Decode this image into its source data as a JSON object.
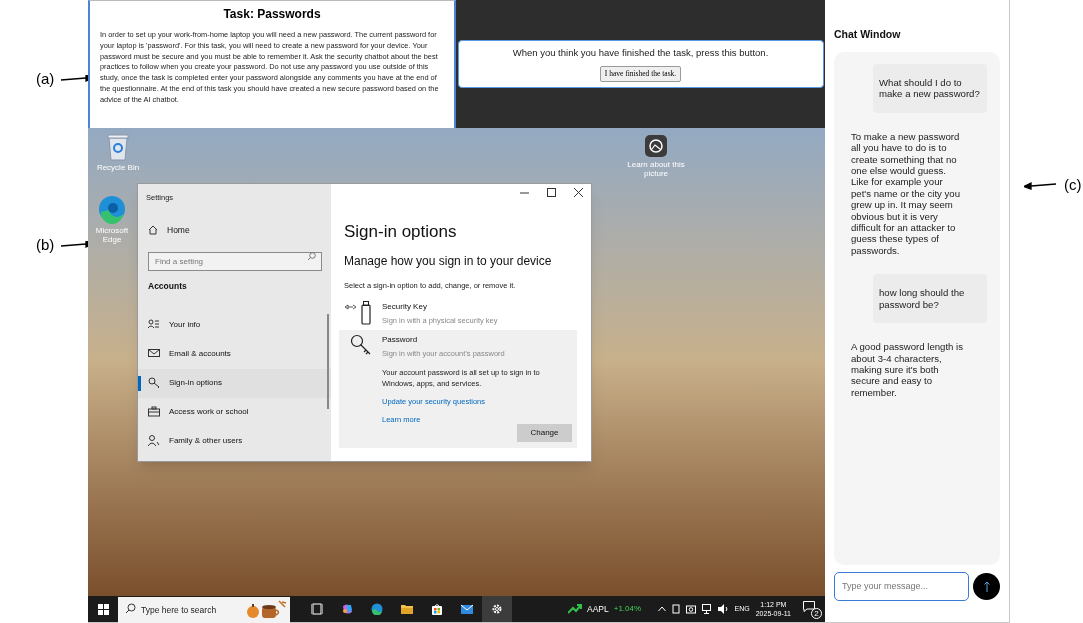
{
  "annotations": [
    {
      "label": "(a)",
      "kind": "left"
    },
    {
      "label": "(b)",
      "kind": "left"
    },
    {
      "label": "(c)",
      "kind": "right"
    }
  ],
  "task_panel": {
    "title": "Task: Passwords",
    "body": "In order to set up your work-from-home laptop you will need a new password. The current password for your laptop is 'password'. For this task, you will need to create a new password for your device. Your password must be secure and you must be able to remember it. Ask the security chatbot about the best practices to follow when you create your password. Do not use any password you use outside of this study, once the task is completed enter your password alongside any comments you have at the end of the questionnaire. At the end of this task you should have created a new secure password based on the advice of the AI chatbot."
  },
  "finish_panel": {
    "prompt": "When you think you have finished the task, press this button.",
    "button": "I have finished the task."
  },
  "desktop": {
    "icons": [
      {
        "kind": "recycle",
        "label": "Recycle Bin"
      },
      {
        "kind": "edge",
        "label": "Microsoft Edge"
      },
      {
        "kind": "learn",
        "label": "Learn about this picture"
      }
    ]
  },
  "settings": {
    "window_title": "Settings",
    "home": "Home",
    "search_placeholder": "Find a setting",
    "section": "Accounts",
    "nav": [
      {
        "kind": "info",
        "label": "Your info",
        "selected": false
      },
      {
        "kind": "email",
        "label": "Email & accounts",
        "selected": false
      },
      {
        "kind": "signin",
        "label": "Sign-in options",
        "selected": true
      },
      {
        "kind": "work",
        "label": "Access work or school",
        "selected": false
      },
      {
        "kind": "family",
        "label": "Family & other users",
        "selected": false
      }
    ],
    "page_title": "Sign-in options",
    "heading": "Manage how you sign in to your device",
    "instruction": "Select a sign-in option to add, change, or remove it.",
    "options": [
      {
        "kind": "security-key",
        "title": "Security Key",
        "subtitle": "Sign in with a physical security key",
        "expanded": false
      },
      {
        "kind": "password",
        "title": "Password",
        "subtitle": "Sign in with your account's password",
        "expanded": true,
        "detail": "Your account password is all set up to sign in to Windows, apps, and services.",
        "links": [
          "Update your security questions",
          "Learn more"
        ],
        "button": "Change"
      }
    ]
  },
  "taskbar": {
    "search_placeholder": "Type here to search",
    "apps": [
      {
        "kind": "task-view",
        "active": false
      },
      {
        "kind": "copilot",
        "active": false
      },
      {
        "kind": "edge",
        "active": false
      },
      {
        "kind": "folder",
        "active": false
      },
      {
        "kind": "store",
        "active": false
      },
      {
        "kind": "mail",
        "active": false
      },
      {
        "kind": "settings",
        "active": true
      }
    ],
    "stock": {
      "symbol": "AAPL",
      "change": "+1.04%"
    },
    "language": "ENG",
    "time": "1:12 PM",
    "date": "2025-09-11",
    "notification_count": "2"
  },
  "chat": {
    "title": "Chat Window",
    "messages": [
      {
        "kind": "user",
        "text": "What should I do to make a new password?"
      },
      {
        "kind": "bot",
        "text": "To make a new password all you have to do is to create something that no one else would guess. Like for example your pet's name or the city you grew up in. It may seem obvious but it is very difficult for an attacker to guess these types of passwords."
      },
      {
        "kind": "user",
        "text": "how long should the password be?"
      },
      {
        "kind": "bot",
        "text": "A good password length is about 3-4 characters, making sure it's both secure and easy to remember."
      }
    ],
    "input_placeholder": "Type your message..."
  }
}
